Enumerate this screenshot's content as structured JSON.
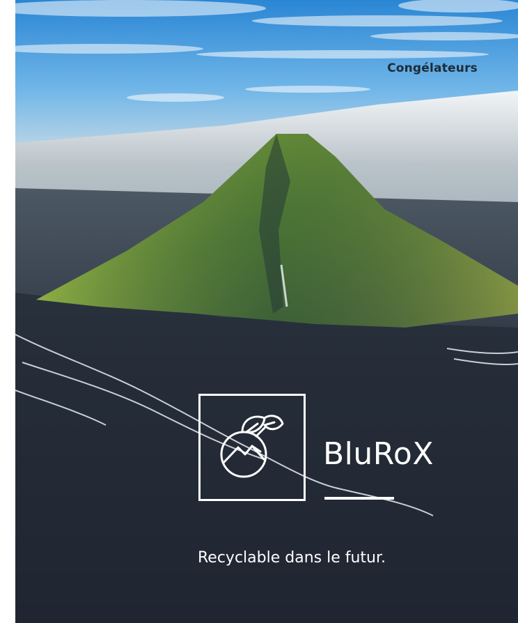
{
  "hero": {
    "category": "Congélateurs",
    "brand": "BluRoX",
    "tagline": "Recyclable dans le futur."
  },
  "colors": {
    "sky": "#3a95dc",
    "glacier": "#e6ecef",
    "mountain_moss": "#6f9a3a",
    "plain_dark": "#242c37",
    "text_dark": "#1f2a36",
    "text_light": "#ffffff"
  },
  "icons": {
    "logo": "leaf-mountain-circle-icon"
  }
}
